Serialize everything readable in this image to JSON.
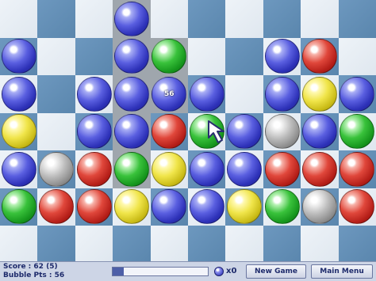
{
  "board": {
    "rows": [
      [
        "",
        "",
        "",
        "blue",
        "",
        "",
        "",
        "",
        "",
        ""
      ],
      [
        "blue",
        "",
        "",
        "blue",
        "green",
        "",
        "",
        "blue",
        "red",
        ""
      ],
      [
        "blue",
        "",
        "blue",
        "blue",
        "blue",
        "blue",
        "",
        "blue",
        "yellow",
        "blue"
      ],
      [
        "yellow",
        "",
        "blue",
        "blue",
        "red",
        "green",
        "blue",
        "gray",
        "blue",
        "green"
      ],
      [
        "blue",
        "gray",
        "red",
        "green",
        "yellow",
        "blue",
        "blue",
        "red",
        "red",
        "red"
      ],
      [
        "green",
        "red",
        "red",
        "yellow",
        "blue",
        "blue",
        "yellow",
        "green",
        "gray",
        "red"
      ]
    ],
    "selected_columns": [
      3,
      4
    ],
    "selected_group_value_label": "56"
  },
  "status": {
    "score_label": "Score :",
    "score_value": "62 (5)",
    "bubble_pts_label": "Bubble Pts :",
    "bubble_pts_value": "56",
    "progress_percent": 12,
    "bubbles_remaining_label": "x0"
  },
  "buttons": {
    "new_game": "New Game",
    "main_menu": "Main Menu"
  },
  "icons": {
    "cursor": "arrow-cursor-icon",
    "bubble": "bubble-icon"
  },
  "colors": {
    "tile_light": "#e6edf4",
    "tile_dark": "#628fb6",
    "status_bg": "#cdd5e6",
    "accent": "#1d2a6b"
  }
}
